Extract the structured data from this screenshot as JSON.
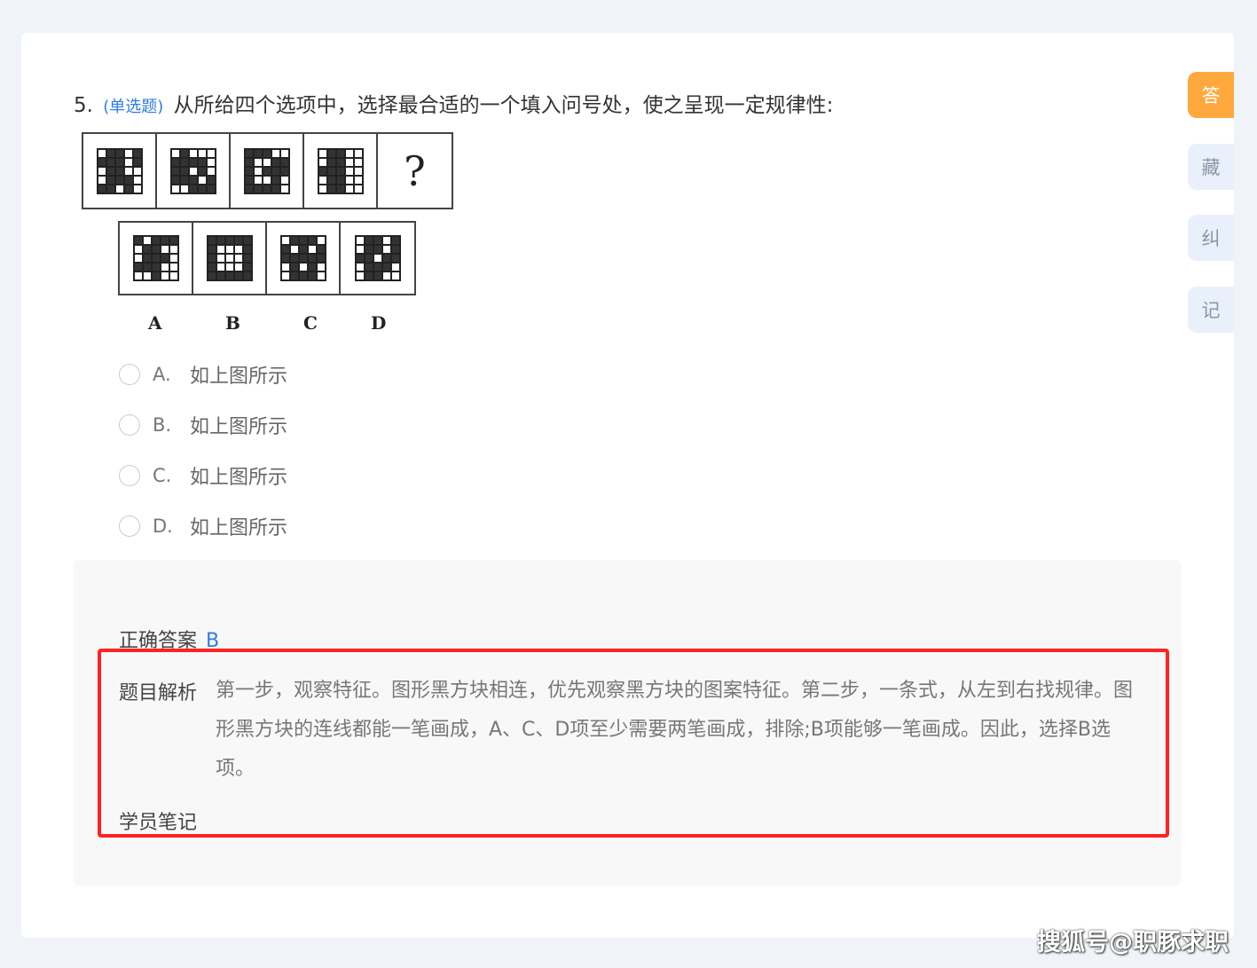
{
  "question": {
    "number": "5.",
    "type": "(单选题)",
    "text": "从所给四个选项中，选择最合适的一个填入问号处，使之呈现一定规律性:"
  },
  "puzzle": {
    "question_mark": "?",
    "option_letters": [
      "A",
      "B",
      "C",
      "D"
    ]
  },
  "options": [
    {
      "letter": "A.",
      "text": "如上图所示"
    },
    {
      "letter": "B.",
      "text": "如上图所示"
    },
    {
      "letter": "C.",
      "text": "如上图所示"
    },
    {
      "letter": "D.",
      "text": "如上图所示"
    }
  ],
  "analysis": {
    "answer_label": "正确答案",
    "answer_value": "B",
    "explain_label": "题目解析",
    "explain_text": "第一步，观察特征。图形黑方块相连，优先观察黑方块的图案特征。第二步，一条式，从左到右找规律。图形黑方块的连线都能一笔画成，A、C、D项至少需要两笔画成，排除;B项能够一笔画成。因此，选择B选项。",
    "note_label": "学员笔记"
  },
  "sidebar": [
    "答",
    "藏",
    "纠",
    "记"
  ],
  "watermark": "搜狐号@职豚求职",
  "colors": {
    "accent": "#2f7be6",
    "active_tab": "#fea83d",
    "highlight_box": "#ff2222"
  }
}
